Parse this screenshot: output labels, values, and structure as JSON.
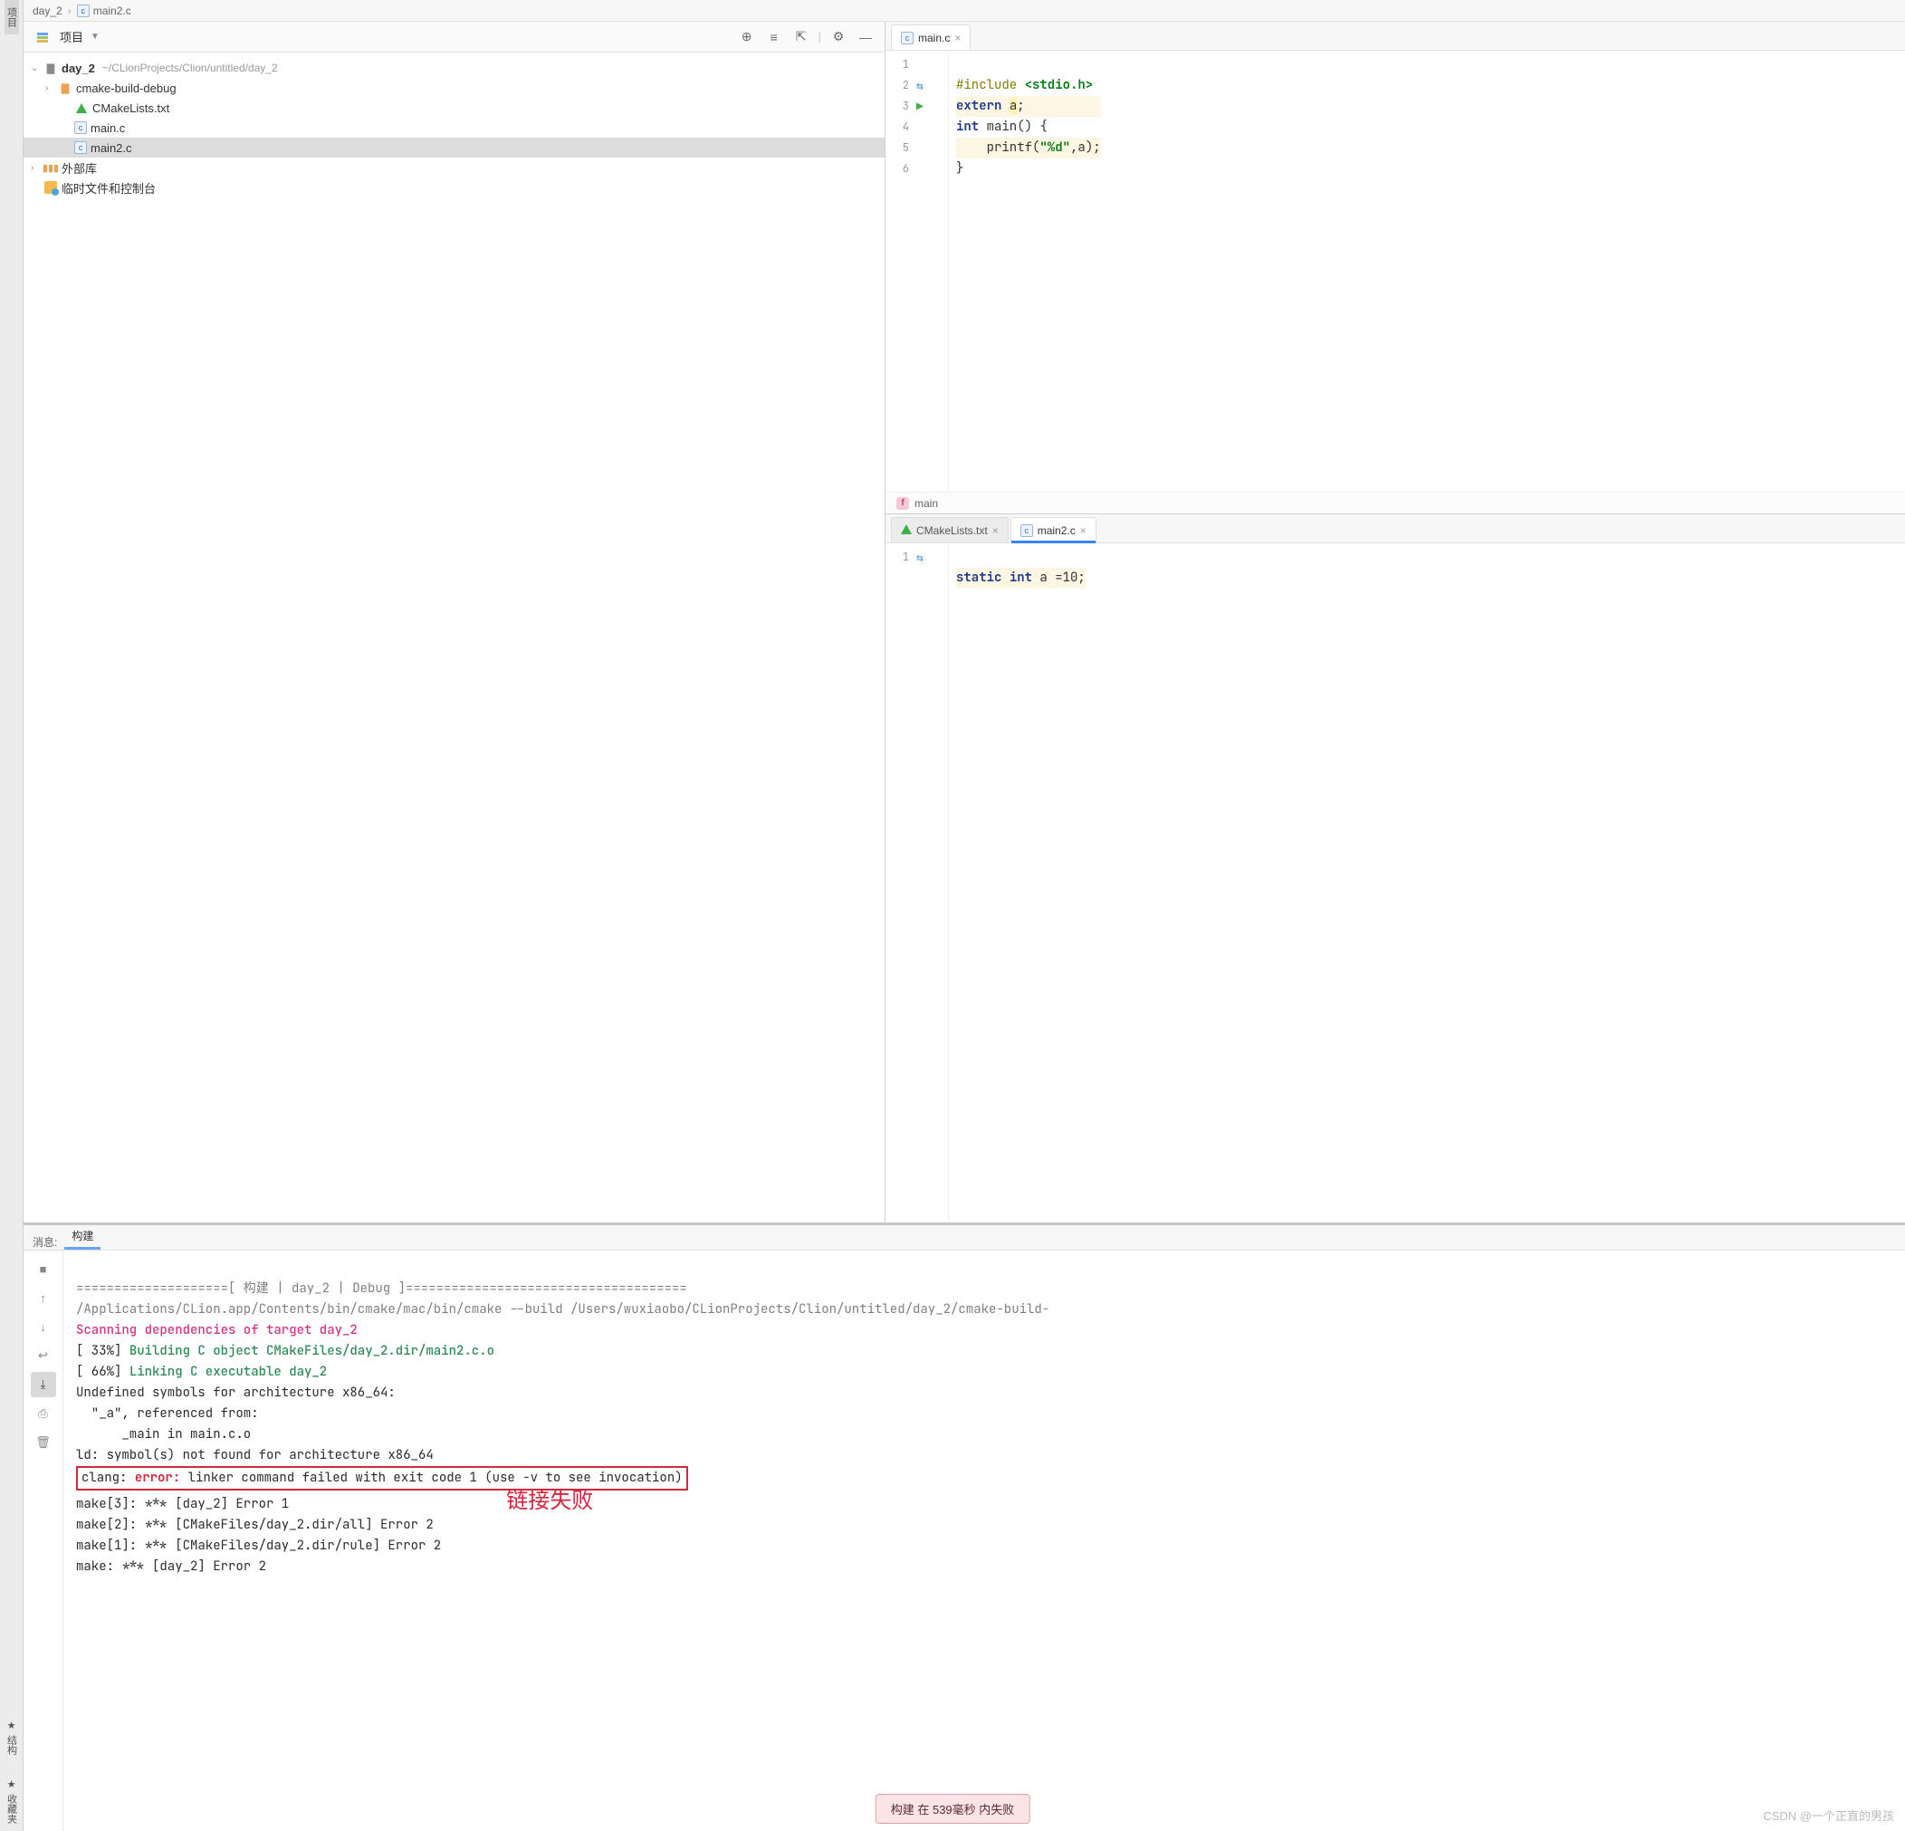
{
  "breadcrumb": {
    "item1": "day_2",
    "item2": "main2.c"
  },
  "left_rail": {
    "project": "项目",
    "structure": "结构",
    "bookmarks": "收藏夹"
  },
  "project_panel": {
    "title": "项目",
    "root": {
      "name": "day_2",
      "path": "~/CLionProjects/Clion/untitled/day_2"
    },
    "cmake_build": "cmake-build-debug",
    "cmakelists": "CMakeLists.txt",
    "mainc": "main.c",
    "main2c": "main2.c",
    "extlib": "外部库",
    "scratch": "临时文件和控制台"
  },
  "editor_top": {
    "tab": "main.c",
    "lines": {
      "1": {
        "include": "#include",
        "header": "<stdio.h>"
      },
      "2": {
        "extern": "extern",
        "a": "a",
        "semi": ";"
      },
      "3": {
        "int": "int",
        "main": " main() {"
      },
      "4": {
        "printf": "    printf(",
        "fmt": "\"%d\"",
        "rest": ",a);"
      },
      "5": {
        "brace": "}"
      }
    },
    "crumb_func": "main"
  },
  "editor_bottom": {
    "tab1": "CMakeLists.txt",
    "tab2": "main2.c",
    "line1": {
      "static": "static",
      "int": "int",
      "rest": " a =10;"
    }
  },
  "messages": {
    "label": "消息:",
    "tab_build": "构建",
    "header": "====================[ 构建 | day_2 | Debug ]=====================================",
    "cmd": "/Applications/CLion.app/Contents/bin/cmake/mac/bin/cmake --build /Users/wuxiaobo/CLionProjects/Clion/untitled/day_2/cmake-build-",
    "scanning": "Scanning dependencies of target day_2",
    "p33_pre": "[ 33%] ",
    "p33": "Building C object CMakeFiles/day_2.dir/main2.c.o",
    "p66_pre": "[ 66%] ",
    "p66": "Linking C executable day_2",
    "undef": "Undefined symbols for architecture x86_64:",
    "ref1": "  \"_a\", referenced from:",
    "ref2": "      _main in main.c.o",
    "ld": "ld: symbol(s) not found for architecture x86_64",
    "clang_pre": "clang: ",
    "clang_err": "error:",
    "clang_rest": " linker command failed with exit code 1 (use -v to see invocation)",
    "make3": "make[3]: *** [day_2] Error 1",
    "make2": "make[2]: *** [CMakeFiles/day_2.dir/all] Error 2",
    "make1": "make[1]: *** [CMakeFiles/day_2.dir/rule] Error 2",
    "make0": "make: *** [day_2] Error 2",
    "annotation": "链接失败"
  },
  "status_popup": "构建 在 539毫秒 内失败",
  "watermark": "CSDN @一个正直的男孩"
}
